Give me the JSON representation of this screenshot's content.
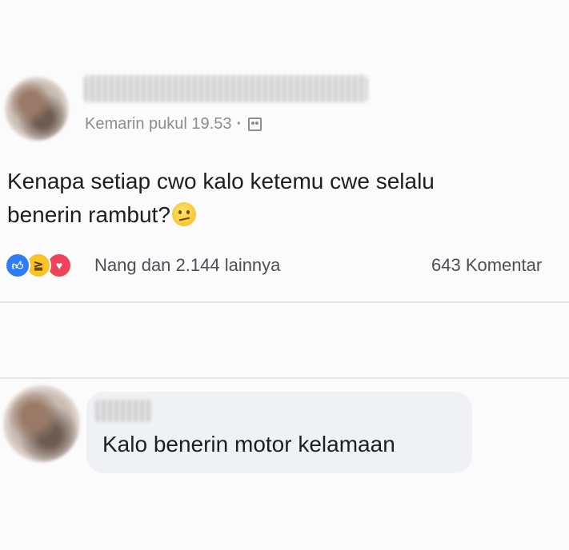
{
  "post": {
    "timestamp": "Kemarin pukul 19.53",
    "separator": "·",
    "audience_icon": "friends-audience-icon",
    "text_line1": "Kenapa setiap cwo kalo ketemu cwe selalu",
    "text_line2": "benerin rambut?",
    "emoji": "confused-face-icon",
    "reactions": {
      "icons": [
        "like-icon",
        "haha-icon",
        "love-icon"
      ],
      "summary": "Nang dan 2.144 lainnya"
    },
    "comments_count": "643 Komentar"
  },
  "comment": {
    "text": "Kalo benerin motor kelamaan"
  },
  "colors": {
    "like": "#2f7df6",
    "haha": "#f7c325",
    "love": "#f0435a",
    "bubble": "#eff1f4",
    "meta_text": "#8a8d91"
  }
}
